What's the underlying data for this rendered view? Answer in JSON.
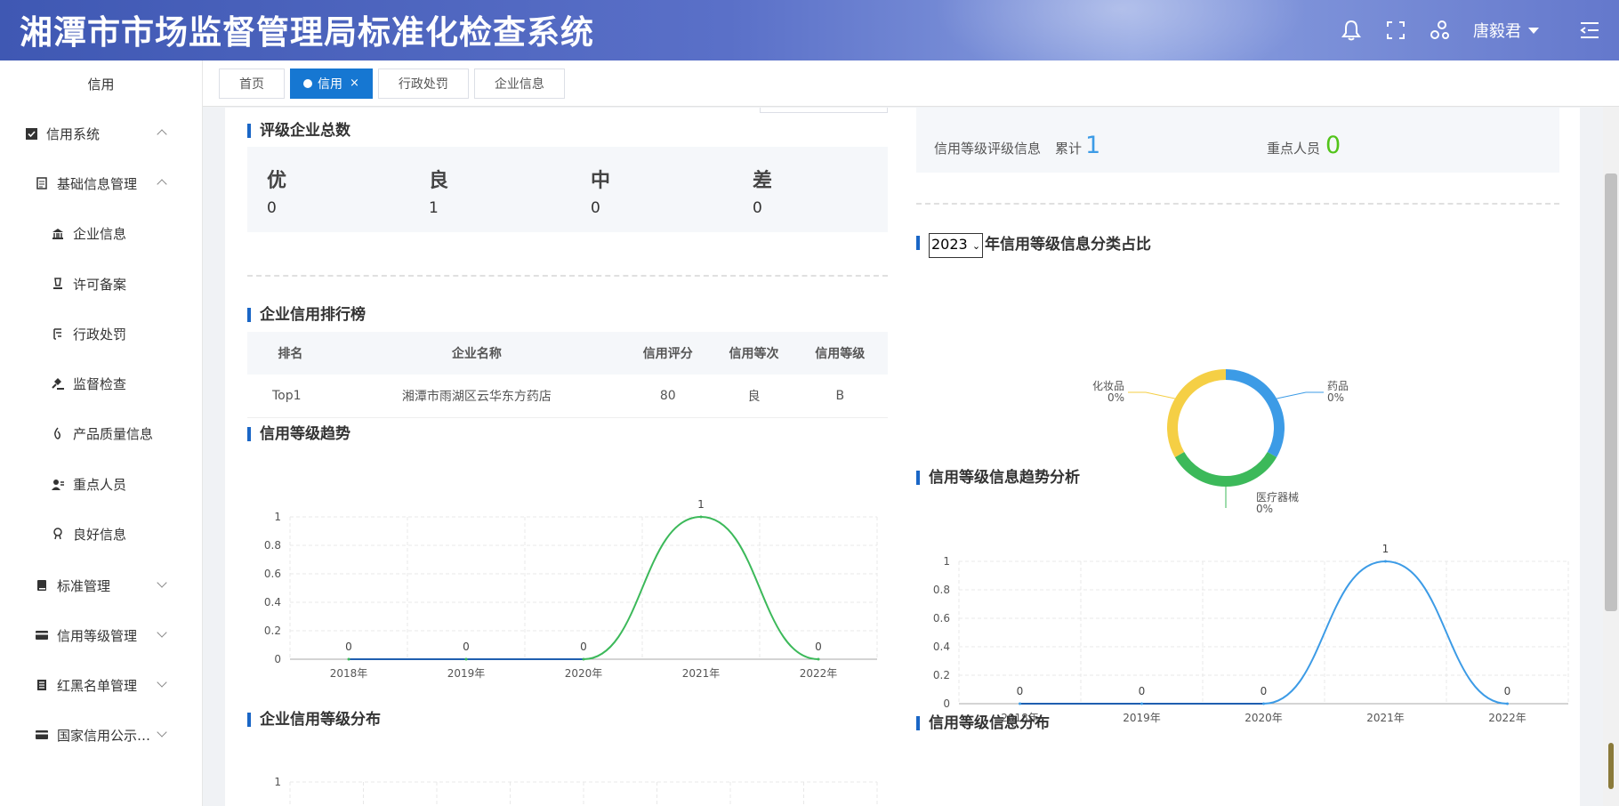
{
  "app": {
    "title": "湘潭市市场监督管理局标准化检查系统",
    "user": "唐毅君"
  },
  "header_icons": [
    "bell-icon",
    "fullscreen-icon",
    "theme-icon",
    "menu-toggle-icon"
  ],
  "sidebar": {
    "title": "信用",
    "items": [
      {
        "label": "信用系统",
        "icon": "checkbox-icon",
        "level": 1,
        "expanded": true
      },
      {
        "label": "基础信息管理",
        "icon": "document-icon",
        "level": 2,
        "expanded": true
      },
      {
        "label": "企业信息",
        "icon": "bank-icon",
        "level": 3
      },
      {
        "label": "许可备案",
        "icon": "license-icon",
        "level": 3
      },
      {
        "label": "行政处罚",
        "icon": "penalty-icon",
        "level": 3
      },
      {
        "label": "监督检查",
        "icon": "gavel-icon",
        "level": 3
      },
      {
        "label": "产品质量信息",
        "icon": "flame-icon",
        "level": 3
      },
      {
        "label": "重点人员",
        "icon": "person-card-icon",
        "level": 3
      },
      {
        "label": "良好信息",
        "icon": "award-icon",
        "level": 3
      },
      {
        "label": "标准管理",
        "icon": "book-icon",
        "level": 2,
        "expanded": false
      },
      {
        "label": "信用等级管理",
        "icon": "card-icon",
        "level": 2,
        "expanded": false
      },
      {
        "label": "红黑名单管理",
        "icon": "list-icon",
        "level": 2,
        "expanded": false
      },
      {
        "label": "国家信用公示…",
        "icon": "card-icon",
        "level": 2,
        "expanded": false
      }
    ]
  },
  "tabs": [
    {
      "label": "首页",
      "active": false
    },
    {
      "label": "信用",
      "active": true,
      "closable": true,
      "close": "×"
    },
    {
      "label": "行政处罚",
      "active": false
    },
    {
      "label": "企业信息",
      "active": false
    }
  ],
  "left": {
    "grades_title": "评级企业总数",
    "grades": [
      {
        "label": "优",
        "value": "0"
      },
      {
        "label": "良",
        "value": "1"
      },
      {
        "label": "中",
        "value": "0"
      },
      {
        "label": "差",
        "value": "0"
      }
    ],
    "ranking_title": "企业信用排行榜",
    "ranking_columns": [
      "排名",
      "企业名称",
      "信用评分",
      "信用等次",
      "信用等级"
    ],
    "ranking_rows": [
      [
        "Top1",
        "湘潭市雨湖区云华东方药店",
        "80",
        "良",
        "B"
      ]
    ],
    "trend_title": "信用等级趋势",
    "distribution_title": "企业信用等级分布"
  },
  "right": {
    "stat1_label": "信用等级评级信息",
    "stat1_sub": "累计",
    "stat1_value": "1",
    "stat2_label": "重点人员",
    "stat2_value": "0",
    "year": "2023",
    "pie_title": "年信用等级信息分类占比",
    "trend_title": "信用等级信息趋势分析",
    "distribution_title": "信用等级信息分布"
  },
  "colors": {
    "header": "#4a62bd",
    "primary": "#1677d2",
    "green_series": "#3cb95a",
    "blue_series": "#3c9be6",
    "pie_drug": "#3c9be6",
    "pie_device": "#3cb95a",
    "pie_cosmetic": "#f5cf45",
    "stat1": "#3c9be6",
    "stat2": "#52c41a"
  },
  "chart_data": [
    {
      "type": "line",
      "title": "信用等级趋势",
      "categories": [
        "2018年",
        "2019年",
        "2020年",
        "2021年",
        "2022年"
      ],
      "series": [
        {
          "values": [
            0,
            0,
            0,
            1,
            0
          ]
        }
      ],
      "smooth": true,
      "data_labels": [
        "0",
        "0",
        "0",
        "1",
        "0"
      ],
      "yticks": [
        "0",
        "0.2",
        "0.4",
        "0.6",
        "0.8",
        "1"
      ],
      "ylim": [
        0,
        1
      ],
      "grid": true
    },
    {
      "type": "pie",
      "title": "2023年信用等级信息分类占比",
      "donut": true,
      "slices": [
        {
          "label": "药品",
          "pct": "0%"
        },
        {
          "label": "医疗器械",
          "pct": "0%"
        },
        {
          "label": "化妆品",
          "pct": "0%"
        }
      ]
    },
    {
      "type": "line",
      "title": "信用等级信息趋势分析",
      "categories": [
        "2018年",
        "2019年",
        "2020年",
        "2021年",
        "2022年"
      ],
      "series": [
        {
          "values": [
            0,
            0,
            0,
            1,
            0
          ]
        }
      ],
      "smooth": true,
      "data_labels": [
        "0",
        "0",
        "0",
        "1",
        "0"
      ],
      "yticks": [
        "0",
        "0.2",
        "0.4",
        "0.6",
        "0.8",
        "1"
      ],
      "ylim": [
        0,
        1
      ],
      "grid": true
    },
    {
      "type": "bar",
      "title": "企业信用等级分布",
      "yticks_visible": [
        "1"
      ]
    }
  ]
}
